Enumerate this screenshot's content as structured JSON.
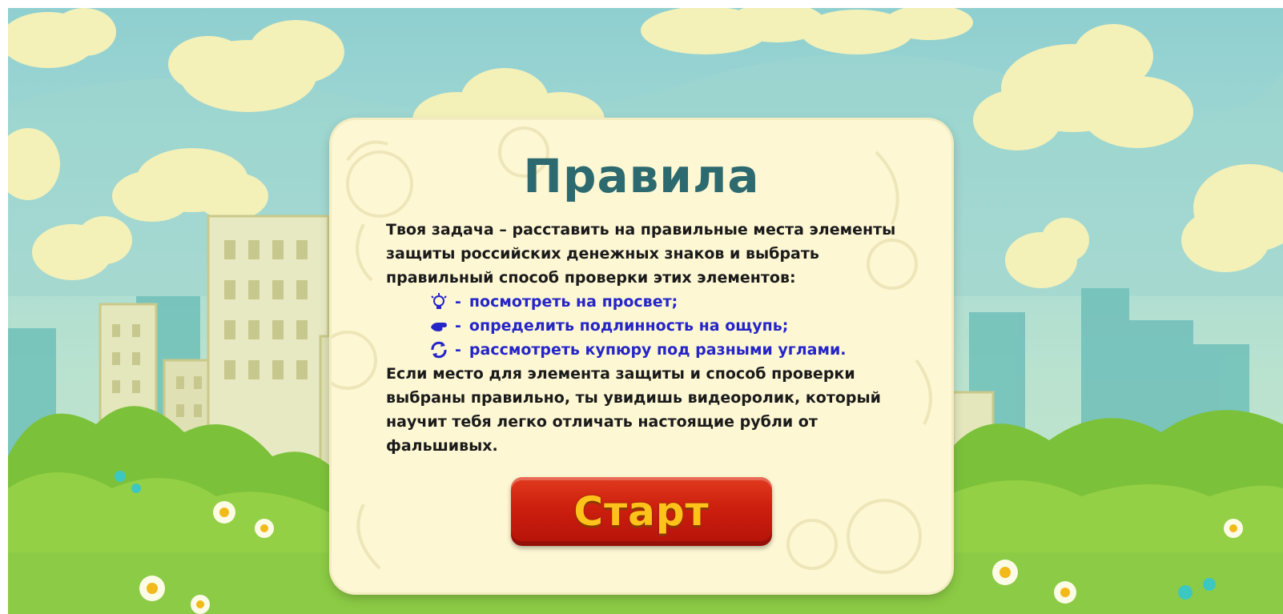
{
  "rules": {
    "title": "Правила",
    "intro": "Твоя задача – расставить на правильные места элементы защиты  российских денежных знаков и выбрать правильный способ проверки этих элементов:",
    "methods": [
      {
        "icon": "light-bulb-icon",
        "text": "посмотреть на просвет;"
      },
      {
        "icon": "hand-touch-icon",
        "text": "определить подлинность на ощупь;"
      },
      {
        "icon": "rotate-arrows-icon",
        "text": "рассмотреть купюру под разными углами."
      }
    ],
    "method_dash": "-",
    "outro": "Если  место для элемента  защиты и способ проверки выбраны правильно, ты увидишь видеоролик, который научит тебя легко отличать настоящие рубли от фальшивых.",
    "start_label": "Старт"
  },
  "colors": {
    "title": "#2d6a70",
    "method_text": "#2525c8",
    "body_text": "#1a1a1a",
    "button": "#cc1f0e",
    "button_text": "#ffc21a",
    "panel": "#fdf7d4"
  }
}
